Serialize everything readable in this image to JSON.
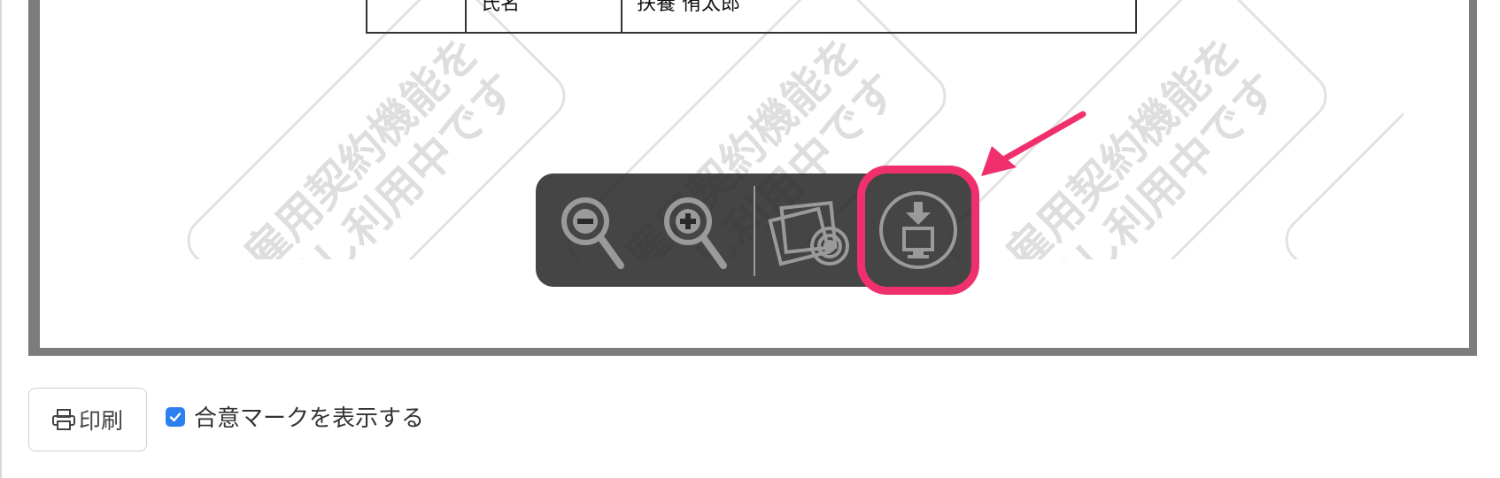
{
  "document": {
    "row_label": "氏名",
    "row_value": "扶養 侑太郎"
  },
  "watermark": {
    "line1": "雇用契約機能を",
    "line2": "試し利用中です"
  },
  "toolbar": {
    "zoom_out_icon": "zoom-out-icon",
    "zoom_in_icon": "zoom-in-icon",
    "image_icon": "image-icon",
    "download_icon": "download-to-computer-icon"
  },
  "annotation": {
    "highlight_color": "#f0306d"
  },
  "footer": {
    "print_label": "印刷",
    "print_icon": "printer-icon",
    "agree_checked": true,
    "agree_label": "合意マークを表示する",
    "accent_color": "#2d7ff0"
  }
}
